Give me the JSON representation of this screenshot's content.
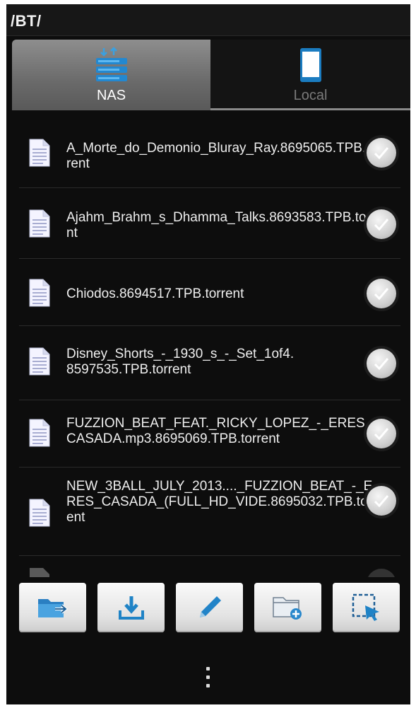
{
  "titlebar": {
    "path": "/BT/"
  },
  "tabs": [
    {
      "label": "NAS",
      "icon": "nas-icon",
      "active": true
    },
    {
      "label": "Local",
      "icon": "phone-icon",
      "active": false
    }
  ],
  "files": [
    {
      "name": "A_Morte_do_Demonio_Bluray_Ray.8695065.TPB.torrent",
      "icon": "file-icon"
    },
    {
      "name": "Ajahm_Brahm_s_Dhamma_Talks.8693583.TPB.torrent",
      "icon": "file-icon"
    },
    {
      "name": "Chiodos.8694517.TPB.torrent",
      "icon": "file-icon"
    },
    {
      "name": "Disney_Shorts_-_1930_s_-_Set_1of4.8597535.TPB.torrent",
      "icon": "file-icon"
    },
    {
      "name": "FUZZION_BEAT_FEAT._RICKY_LOPEZ_-_ERES_CASADA.mp3.8695069.TPB.torrent",
      "icon": "file-icon"
    },
    {
      "name": "NEW_3BALL_JULY_2013...._FUZZION_BEAT_-_ERES_CASADA_(FULL_HD_VIDE.8695032.TPB.torrent",
      "icon": "file-icon"
    }
  ],
  "toolbar": [
    {
      "icon": "move-folder-icon"
    },
    {
      "icon": "download-icon"
    },
    {
      "icon": "edit-pen-icon"
    },
    {
      "icon": "new-folder-icon"
    },
    {
      "icon": "select-icon"
    }
  ],
  "colors": {
    "accent": "#1d7fc1",
    "background": "#0d0d0d",
    "text": "#eeeeee"
  }
}
